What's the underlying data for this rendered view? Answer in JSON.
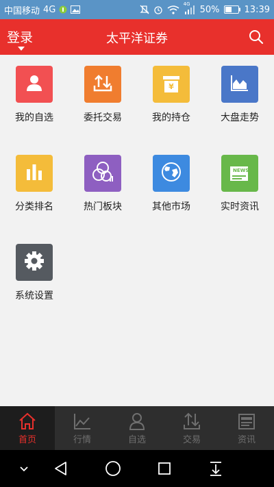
{
  "status_bar": {
    "carrier": "中国移动",
    "network": "4G",
    "signal_tag": "4G",
    "battery": "50%",
    "time": "13:39"
  },
  "header": {
    "login_label": "登录",
    "title": "太平洋证券"
  },
  "tiles": [
    {
      "label": "我的自选",
      "icon": "user-icon",
      "color": "#f25052"
    },
    {
      "label": "委托交易",
      "icon": "trade-icon",
      "color": "#f07d2f"
    },
    {
      "label": "我的持仓",
      "icon": "holdings-icon",
      "color": "#f4bc3a"
    },
    {
      "label": "大盘走势",
      "icon": "market-trend-icon",
      "color": "#4a77c8"
    },
    {
      "label": "分类排名",
      "icon": "bar-chart-icon",
      "color": "#f4bc3a"
    },
    {
      "label": "热门板块",
      "icon": "hot-sectors-icon",
      "color": "#8e5fc1"
    },
    {
      "label": "其他市场",
      "icon": "globe-icon",
      "color": "#3d8ae0"
    },
    {
      "label": "实时资讯",
      "icon": "news-icon",
      "color": "#68b84a"
    },
    {
      "label": "系统设置",
      "icon": "gear-icon",
      "color": "#555a60"
    }
  ],
  "tabs": [
    {
      "label": "首页",
      "icon": "home-icon"
    },
    {
      "label": "行情",
      "icon": "quotes-icon"
    },
    {
      "label": "自选",
      "icon": "watchlist-icon"
    },
    {
      "label": "交易",
      "icon": "trade-tab-icon"
    },
    {
      "label": "资讯",
      "icon": "news-tab-icon"
    }
  ],
  "tile_badge": {
    "holdings": "¥",
    "news": "NEWS"
  },
  "colors": {
    "header": "#e8302c",
    "status_bar": "#5a94c6",
    "tab_active": "#e8302c",
    "tab_inactive": "#6f6f6f"
  }
}
